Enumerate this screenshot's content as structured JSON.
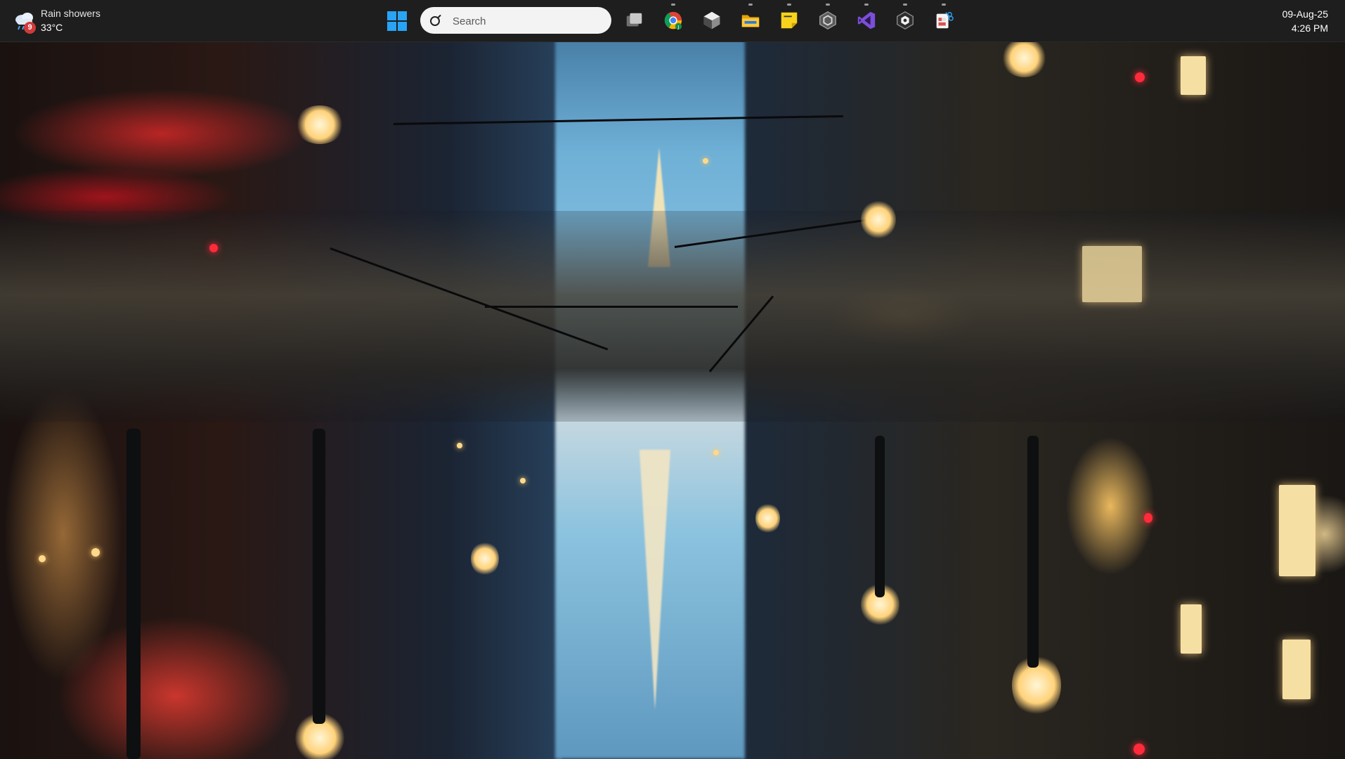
{
  "weather": {
    "condition": "Rain showers",
    "temperature": "33°C",
    "badge": "9",
    "icon": "cloud-rain-icon"
  },
  "search": {
    "placeholder": "Search",
    "icon": "search-icon"
  },
  "taskbar": {
    "start_icon": "windows-start-icon",
    "apps": [
      {
        "name": "task-view",
        "icon": "task-view-icon"
      },
      {
        "name": "chrome",
        "icon": "chrome-icon"
      },
      {
        "name": "unity-hub",
        "icon": "unity-icon"
      },
      {
        "name": "file-explorer",
        "icon": "folder-icon"
      },
      {
        "name": "sticky-notes",
        "icon": "sticky-note-icon"
      },
      {
        "name": "unity-editor",
        "icon": "unity-hex-icon"
      },
      {
        "name": "visual-studio",
        "icon": "visual-studio-icon"
      },
      {
        "name": "unity-editor-2",
        "icon": "unity-hex-dark-icon"
      },
      {
        "name": "snipping-tool",
        "icon": "snipping-tool-icon"
      }
    ]
  },
  "clock": {
    "time": "4:26 PM",
    "date": "09-Aug-25"
  },
  "colors": {
    "taskbar_bg": "#1e1e1e",
    "search_bg": "#f3f3f3",
    "accent_blue": "#29a3f5"
  }
}
